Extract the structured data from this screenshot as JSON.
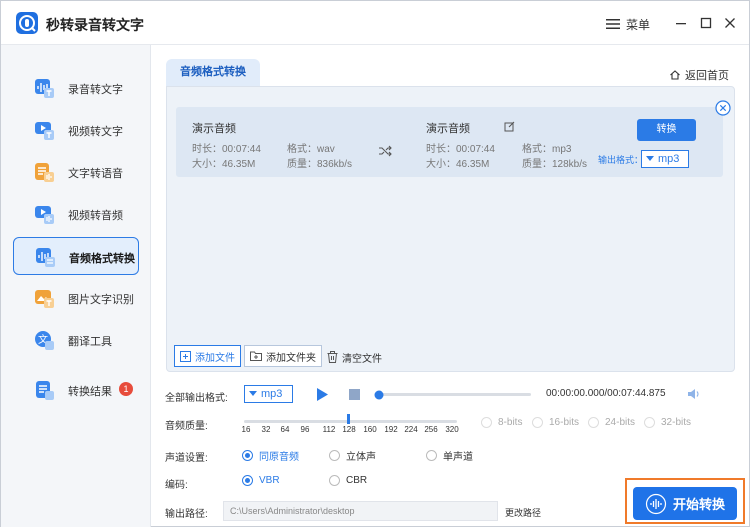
{
  "app": {
    "title": "秒转录音转文字",
    "menu_label": "菜单"
  },
  "sidebar": {
    "items": [
      {
        "label": "录音转文字",
        "icon": "audio-to-text-icon"
      },
      {
        "label": "视频转文字",
        "icon": "video-to-text-icon"
      },
      {
        "label": "文字转语音",
        "icon": "text-to-speech-icon"
      },
      {
        "label": "视频转音频",
        "icon": "video-to-audio-icon"
      },
      {
        "label": "音频格式转换",
        "icon": "audio-format-icon"
      },
      {
        "label": "图片文字识别",
        "icon": "image-ocr-icon"
      },
      {
        "label": "翻译工具",
        "icon": "translate-icon"
      },
      {
        "label": "转换结果",
        "icon": "results-icon",
        "badge": "1"
      }
    ]
  },
  "main": {
    "tab_label": "音频格式转换",
    "home_link": "返回首页",
    "file": {
      "source": {
        "name": "演示音频",
        "duration": "时长：00:07:44",
        "size": "大小：46.35M",
        "format": "格式：wav",
        "quality": "质量：836kb/s"
      },
      "target": {
        "name": "演示音频",
        "duration": "时长：00:07:44",
        "size": "大小：46.35M",
        "format": "格式：mp3",
        "quality": "质量：128kb/s"
      },
      "convert_label": "转换",
      "output_format_label": "输出格式：",
      "output_format_value": "mp3"
    },
    "toolbar": {
      "add_file": "添加文件",
      "add_folder": "添加文件夹",
      "clear": "清空文件"
    }
  },
  "settings": {
    "all_format_label": "全部输出格式:",
    "all_format_value": "mp3",
    "time_display": "00:00:00.000/00:07:44.875",
    "playback_progress": 0,
    "quality_label": "音频质量:",
    "quality_ticks": [
      "16",
      "32",
      "64",
      "96",
      "112",
      "128",
      "160",
      "192",
      "224",
      "256",
      "320"
    ],
    "quality_selected": "128",
    "bit_options": [
      "8-bits",
      "16-bits",
      "24-bits",
      "32-bits"
    ],
    "channel_label": "声道设置:",
    "channel_options": [
      "同原音频",
      "立体声",
      "单声道"
    ],
    "channel_selected": "同原音频",
    "encoding_label": "编码:",
    "encoding_options": [
      "VBR",
      "CBR"
    ],
    "encoding_selected": "VBR",
    "output_path_label": "输出路径:",
    "output_path_value": "C:\\Users\\Administrator\\desktop",
    "change_path_label": "更改路径"
  },
  "start_button": {
    "label": "开始转换"
  },
  "colors": {
    "accent": "#2b7be6",
    "badge": "#e74c3c",
    "highlight_frame": "#f07a2a"
  }
}
